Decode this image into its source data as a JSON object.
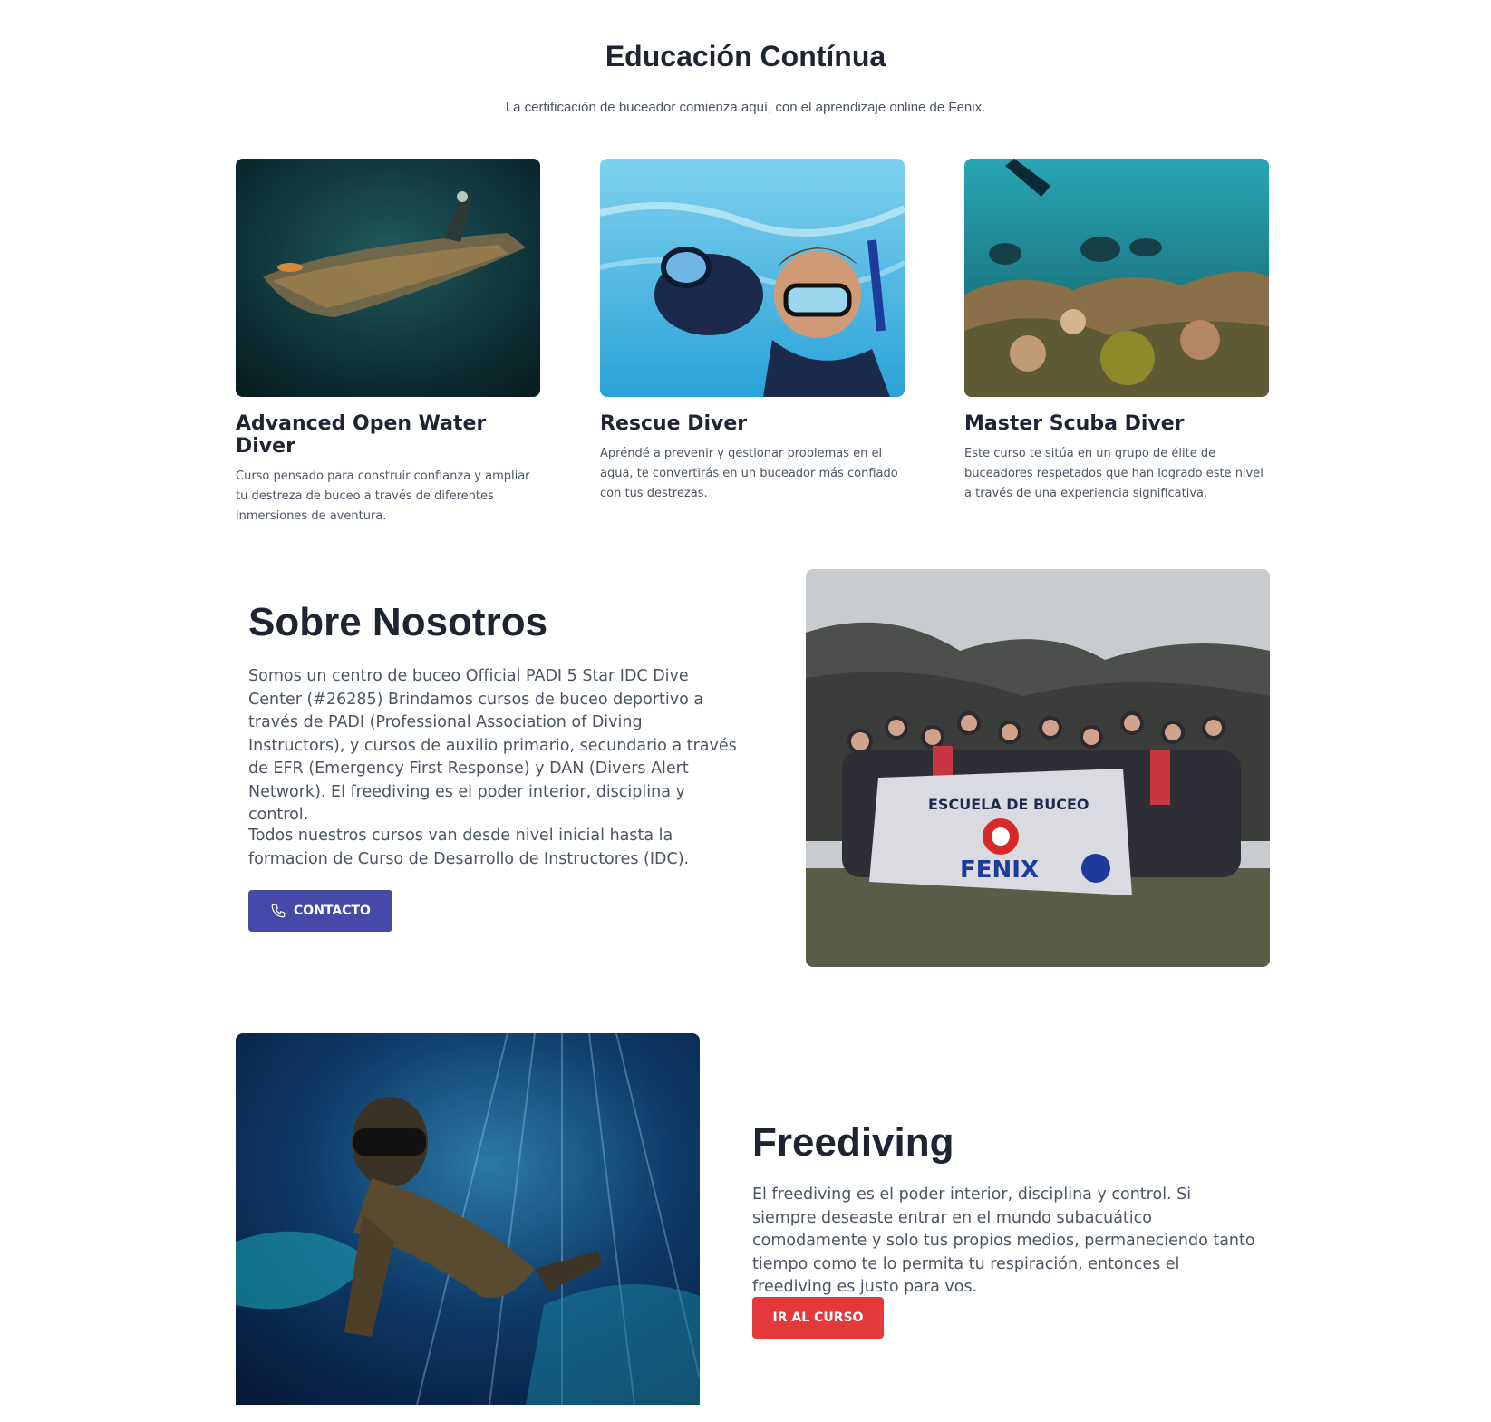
{
  "education": {
    "title": "Educación Contínua",
    "subtitle": "La certificación de buceador comienza aquí, con el aprendizaje online de Fenix.",
    "cards": [
      {
        "title": "Advanced Open Water Diver",
        "description": "Curso pensado para construir confianza y ampliar tu destreza de buceo a través de diferentes inmersiones de aventura."
      },
      {
        "title": "Rescue Diver",
        "description": "Apréndé a prevenir y gestionar problemas en el agua, te convertirás en un buceador más confiado con tus destrezas."
      },
      {
        "title": "Master Scuba Diver",
        "description": "Este curso te sitúa en un grupo de élite de buceadores respetados que han logrado este nivel a través de una experiencia significativa."
      }
    ]
  },
  "about": {
    "title": "Sobre Nosotros",
    "paragraph1": "Somos un centro de buceo Official PADI 5 Star IDC Dive Center (#26285) Brindamos cursos de buceo deportivo a través de PADI (Professional Association of Diving Instructors), y cursos de auxilio primario, secundario a través de EFR (Emergency First Response) y DAN (Divers Alert Network). El freediving es el poder interior, disciplina y control.",
    "paragraph2": "Todos nuestros cursos van desde nivel inicial hasta la formacion de Curso de Desarrollo de Instructores (IDC).",
    "button_label": "CONTACTO",
    "button_icon": "phone-icon",
    "banner_text_top": "ESCUELA DE BUCEO",
    "banner_text_main": "FENIX"
  },
  "freediving": {
    "title": "Freediving",
    "paragraph": "El freediving es el poder interior, disciplina y control. Si siempre deseaste entrar en el mundo subacuático comodamente y solo tus propios medios, permaneciendo tanto tiempo como te lo permita tu respiración, entonces el freediving es justo para vos.",
    "button_label": "IR AL CURSO"
  },
  "colors": {
    "contact_button": "#4549a8",
    "course_button": "#e5383b",
    "heading": "#1f2433",
    "body_text": "#4b5563"
  }
}
